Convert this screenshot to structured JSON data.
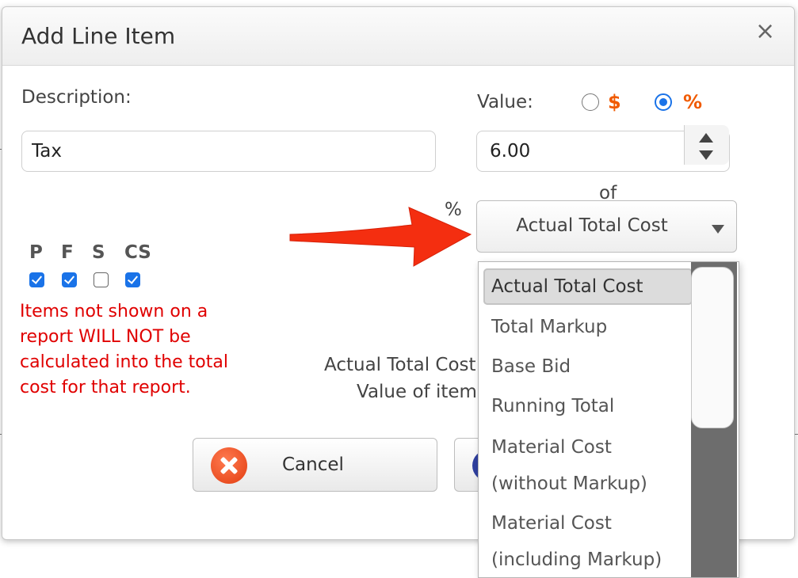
{
  "dialog": {
    "title": "Add Line Item",
    "close": "×"
  },
  "form": {
    "description_label": "Description:",
    "description_value": "Tax",
    "value_label": "Value:",
    "value_type_dollar": "$",
    "value_type_percent": "%",
    "value_type_selected": "%",
    "value": "6.00",
    "of_label": "of",
    "percent_label": "%",
    "base_select": "Actual Total Cost"
  },
  "reports": {
    "headers": [
      "P",
      "F",
      "S",
      "CS"
    ],
    "checked": [
      true,
      true,
      false,
      true
    ]
  },
  "warning": "Items not shown on a report WILL NOT be calculated into the total cost for that report.",
  "summary": {
    "line1": "Actual Total Cost",
    "line2": "Value of item"
  },
  "buttons": {
    "cancel": "Cancel"
  },
  "dropdown": {
    "options": [
      "Actual Total Cost",
      "Total Markup",
      "Base Bid",
      "Running Total",
      "Material Cost",
      "(without Markup)",
      "Material Cost",
      "(including Markup)"
    ],
    "selected": "Actual Total Cost"
  },
  "colors": {
    "accent": "#1a73e8",
    "warning": "#e00000",
    "currency_symbol": "#f05a00",
    "annotation_arrow": "#f42e10"
  }
}
